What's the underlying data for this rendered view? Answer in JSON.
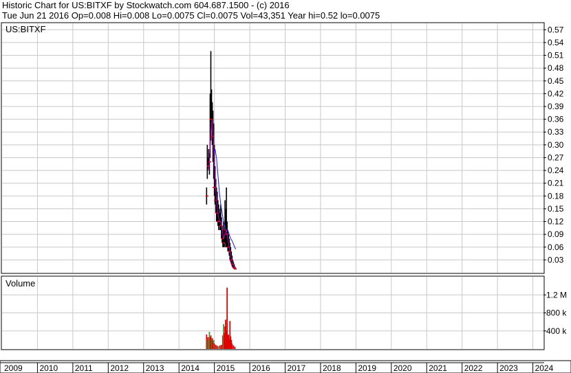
{
  "header": {
    "line1": "Historic Chart for US:BITXF by Stockwatch.com 604.687.1500 - (c) 2016",
    "line2": "Tue Jun 21 2016  Op=0.008  Hi=0.008  Lo=0.0075  Cl=0.0075  Vol=43,351  Year hi=0.52  lo=0.0075"
  },
  "chart_data": [
    {
      "type": "bar",
      "panel": "price",
      "price": {
        "symbol_label": "US:BITXF"
      },
      "ylim": [
        0,
        0.585
      ],
      "yticks": [
        "0.03",
        "0.06",
        "0.09",
        "0.12",
        "0.15",
        "0.18",
        "0.21",
        "0.24",
        "0.27",
        "0.30",
        "0.33",
        "0.36",
        "0.39",
        "0.42",
        "0.45",
        "0.48",
        "0.51",
        "0.54",
        "0.57"
      ],
      "xlim": [
        2009.0,
        2024.3
      ],
      "x_tick_labels": [
        "2009",
        "2010",
        "2011",
        "2012",
        "2013",
        "2014",
        "2015",
        "2016",
        "2017",
        "2018",
        "2019",
        "2020",
        "2021",
        "2022",
        "2023",
        "2024"
      ],
      "grid": true,
      "series": [
        {
          "kind": "high-low",
          "color": "#000000",
          "bars": [
            {
              "x": 2014.78,
              "h": 0.2,
              "l": 0.16
            },
            {
              "x": 2014.8,
              "h": 0.3,
              "l": 0.22
            },
            {
              "x": 2014.82,
              "h": 0.27,
              "l": 0.24
            },
            {
              "x": 2014.84,
              "h": 0.29,
              "l": 0.25
            },
            {
              "x": 2014.86,
              "h": 0.28,
              "l": 0.23
            },
            {
              "x": 2014.88,
              "h": 0.42,
              "l": 0.27
            },
            {
              "x": 2014.9,
              "h": 0.52,
              "l": 0.31
            },
            {
              "x": 2014.92,
              "h": 0.43,
              "l": 0.34
            },
            {
              "x": 2014.94,
              "h": 0.4,
              "l": 0.3
            },
            {
              "x": 2014.96,
              "h": 0.38,
              "l": 0.26
            },
            {
              "x": 2014.98,
              "h": 0.35,
              "l": 0.22
            },
            {
              "x": 2015.0,
              "h": 0.3,
              "l": 0.18
            },
            {
              "x": 2015.02,
              "h": 0.25,
              "l": 0.16
            },
            {
              "x": 2015.04,
              "h": 0.22,
              "l": 0.14
            },
            {
              "x": 2015.06,
              "h": 0.2,
              "l": 0.12
            },
            {
              "x": 2015.08,
              "h": 0.19,
              "l": 0.12
            },
            {
              "x": 2015.1,
              "h": 0.17,
              "l": 0.11
            },
            {
              "x": 2015.12,
              "h": 0.16,
              "l": 0.1
            },
            {
              "x": 2015.14,
              "h": 0.15,
              "l": 0.11
            },
            {
              "x": 2015.16,
              "h": 0.14,
              "l": 0.1
            },
            {
              "x": 2015.18,
              "h": 0.16,
              "l": 0.1
            },
            {
              "x": 2015.2,
              "h": 0.13,
              "l": 0.08
            },
            {
              "x": 2015.22,
              "h": 0.11,
              "l": 0.07
            },
            {
              "x": 2015.24,
              "h": 0.1,
              "l": 0.06
            },
            {
              "x": 2015.26,
              "h": 0.12,
              "l": 0.06
            },
            {
              "x": 2015.28,
              "h": 0.1,
              "l": 0.06
            },
            {
              "x": 2015.3,
              "h": 0.17,
              "l": 0.07
            },
            {
              "x": 2015.32,
              "h": 0.15,
              "l": 0.06
            },
            {
              "x": 2015.34,
              "h": 0.2,
              "l": 0.06
            },
            {
              "x": 2015.36,
              "h": 0.12,
              "l": 0.06
            },
            {
              "x": 2015.38,
              "h": 0.1,
              "l": 0.05
            },
            {
              "x": 2015.4,
              "h": 0.09,
              "l": 0.05
            },
            {
              "x": 2015.42,
              "h": 0.08,
              "l": 0.04
            },
            {
              "x": 2015.44,
              "h": 0.07,
              "l": 0.03
            },
            {
              "x": 2015.46,
              "h": 0.06,
              "l": 0.025
            },
            {
              "x": 2015.48,
              "h": 0.05,
              "l": 0.02
            },
            {
              "x": 2015.5,
              "h": 0.04,
              "l": 0.015
            },
            {
              "x": 2015.52,
              "h": 0.03,
              "l": 0.012
            },
            {
              "x": 2015.54,
              "h": 0.025,
              "l": 0.01
            },
            {
              "x": 2015.56,
              "h": 0.02,
              "l": 0.008
            },
            {
              "x": 2015.58,
              "h": 0.015,
              "l": 0.008
            },
            {
              "x": 2015.6,
              "h": 0.012,
              "l": 0.0075
            }
          ]
        },
        {
          "kind": "close-marks",
          "color": "#e00000",
          "points": [
            {
              "x": 2014.79,
              "y": 0.18
            },
            {
              "x": 2014.83,
              "y": 0.25
            },
            {
              "x": 2014.87,
              "y": 0.26
            },
            {
              "x": 2014.91,
              "y": 0.36
            },
            {
              "x": 2014.95,
              "y": 0.32
            },
            {
              "x": 2014.99,
              "y": 0.2
            },
            {
              "x": 2015.03,
              "y": 0.17
            },
            {
              "x": 2015.07,
              "y": 0.14
            },
            {
              "x": 2015.11,
              "y": 0.12
            },
            {
              "x": 2015.15,
              "y": 0.12
            },
            {
              "x": 2015.19,
              "y": 0.11
            },
            {
              "x": 2015.23,
              "y": 0.08
            },
            {
              "x": 2015.27,
              "y": 0.07
            },
            {
              "x": 2015.31,
              "y": 0.1
            },
            {
              "x": 2015.35,
              "y": 0.09
            },
            {
              "x": 2015.39,
              "y": 0.06
            },
            {
              "x": 2015.43,
              "y": 0.05
            },
            {
              "x": 2015.47,
              "y": 0.03
            },
            {
              "x": 2015.51,
              "y": 0.02
            },
            {
              "x": 2015.55,
              "y": 0.012
            },
            {
              "x": 2015.59,
              "y": 0.009
            }
          ]
        },
        {
          "kind": "line",
          "name": "",
          "color": "#c000c0",
          "points": [
            {
              "x": 2014.82,
              "y": 0.24
            },
            {
              "x": 2014.86,
              "y": 0.26
            },
            {
              "x": 2014.9,
              "y": 0.33
            },
            {
              "x": 2014.94,
              "y": 0.36
            },
            {
              "x": 2014.98,
              "y": 0.3
            },
            {
              "x": 2015.02,
              "y": 0.22
            },
            {
              "x": 2015.06,
              "y": 0.17
            },
            {
              "x": 2015.1,
              "y": 0.14
            },
            {
              "x": 2015.14,
              "y": 0.12
            },
            {
              "x": 2015.18,
              "y": 0.12
            },
            {
              "x": 2015.22,
              "y": 0.1
            },
            {
              "x": 2015.26,
              "y": 0.08
            },
            {
              "x": 2015.3,
              "y": 0.09
            },
            {
              "x": 2015.34,
              "y": 0.1
            },
            {
              "x": 2015.38,
              "y": 0.08
            },
            {
              "x": 2015.42,
              "y": 0.06
            },
            {
              "x": 2015.46,
              "y": 0.04
            },
            {
              "x": 2015.5,
              "y": 0.025
            },
            {
              "x": 2015.55,
              "y": 0.015
            },
            {
              "x": 2015.6,
              "y": 0.01
            }
          ]
        },
        {
          "kind": "line",
          "name": "",
          "color": "#1a1ad0",
          "points": [
            {
              "x": 2014.98,
              "y": 0.28
            },
            {
              "x": 2015.02,
              "y": 0.29
            },
            {
              "x": 2015.06,
              "y": 0.27
            },
            {
              "x": 2015.1,
              "y": 0.23
            },
            {
              "x": 2015.14,
              "y": 0.19
            },
            {
              "x": 2015.18,
              "y": 0.16
            },
            {
              "x": 2015.22,
              "y": 0.14
            },
            {
              "x": 2015.26,
              "y": 0.12
            },
            {
              "x": 2015.3,
              "y": 0.11
            },
            {
              "x": 2015.34,
              "y": 0.1
            },
            {
              "x": 2015.38,
              "y": 0.1
            },
            {
              "x": 2015.42,
              "y": 0.09
            },
            {
              "x": 2015.46,
              "y": 0.08
            },
            {
              "x": 2015.5,
              "y": 0.075
            },
            {
              "x": 2015.55,
              "y": 0.065
            },
            {
              "x": 2015.6,
              "y": 0.055
            }
          ]
        }
      ]
    },
    {
      "type": "bar",
      "panel": "volume",
      "volume": {
        "title": "Volume"
      },
      "ylim": [
        0,
        1600000
      ],
      "yticks": [
        {
          "v": 400000,
          "label": "400 k"
        },
        {
          "v": 800000,
          "label": "800 k"
        },
        {
          "v": 1200000,
          "label": "1.2 M"
        }
      ],
      "grid": true,
      "bars": [
        {
          "x": 2014.78,
          "v": 320000,
          "c": "#e00000"
        },
        {
          "x": 2014.8,
          "v": 200000,
          "c": "#3a9a3a"
        },
        {
          "x": 2014.82,
          "v": 260000,
          "c": "#e00000"
        },
        {
          "x": 2014.84,
          "v": 180000,
          "c": "#3a9a3a"
        },
        {
          "x": 2014.86,
          "v": 380000,
          "c": "#3a9a3a"
        },
        {
          "x": 2014.88,
          "v": 260000,
          "c": "#e00000"
        },
        {
          "x": 2014.9,
          "v": 300000,
          "c": "#e00000"
        },
        {
          "x": 2014.92,
          "v": 220000,
          "c": "#3a9a3a"
        },
        {
          "x": 2014.94,
          "v": 240000,
          "c": "#e00000"
        },
        {
          "x": 2014.96,
          "v": 160000,
          "c": "#e00000"
        },
        {
          "x": 2014.98,
          "v": 200000,
          "c": "#3a9a3a"
        },
        {
          "x": 2015.0,
          "v": 120000,
          "c": "#e00000"
        },
        {
          "x": 2015.04,
          "v": 90000,
          "c": "#e00000"
        },
        {
          "x": 2015.08,
          "v": 70000,
          "c": "#e00000"
        },
        {
          "x": 2015.12,
          "v": 60000,
          "c": "#3a9a3a"
        },
        {
          "x": 2015.16,
          "v": 80000,
          "c": "#e00000"
        },
        {
          "x": 2015.2,
          "v": 90000,
          "c": "#e00000"
        },
        {
          "x": 2015.24,
          "v": 300000,
          "c": "#e00000"
        },
        {
          "x": 2015.26,
          "v": 550000,
          "c": "#3a9a3a"
        },
        {
          "x": 2015.28,
          "v": 350000,
          "c": "#e00000"
        },
        {
          "x": 2015.3,
          "v": 500000,
          "c": "#e00000"
        },
        {
          "x": 2015.32,
          "v": 650000,
          "c": "#e00000"
        },
        {
          "x": 2015.34,
          "v": 400000,
          "c": "#e00000"
        },
        {
          "x": 2015.36,
          "v": 1360000,
          "c": "#e00000"
        },
        {
          "x": 2015.38,
          "v": 300000,
          "c": "#e00000"
        },
        {
          "x": 2015.4,
          "v": 320000,
          "c": "#e00000"
        },
        {
          "x": 2015.42,
          "v": 220000,
          "c": "#e00000"
        },
        {
          "x": 2015.44,
          "v": 620000,
          "c": "#e00000"
        },
        {
          "x": 2015.46,
          "v": 280000,
          "c": "#e00000"
        },
        {
          "x": 2015.48,
          "v": 200000,
          "c": "#e00000"
        },
        {
          "x": 2015.5,
          "v": 120000,
          "c": "#e00000"
        },
        {
          "x": 2015.54,
          "v": 80000,
          "c": "#e00000"
        },
        {
          "x": 2015.58,
          "v": 50000,
          "c": "#e00000"
        }
      ]
    }
  ]
}
